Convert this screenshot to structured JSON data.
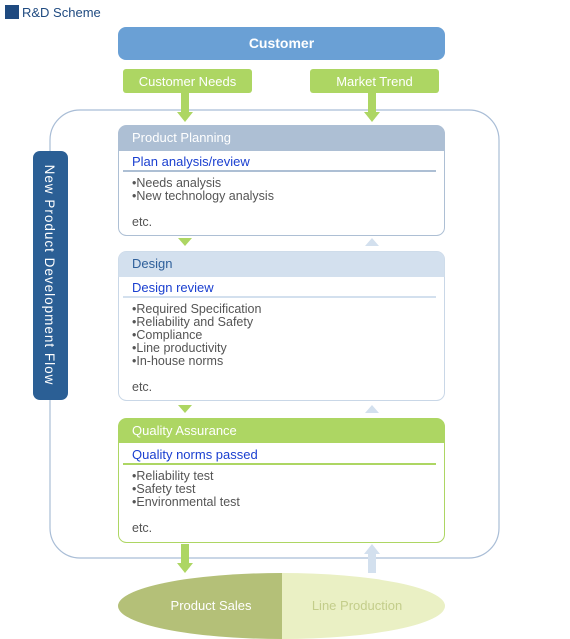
{
  "title": "R&D Scheme",
  "customer": "Customer",
  "inputs": [
    "Customer Needs",
    "Market Trend"
  ],
  "flow_label": "New Product Development Flow",
  "stages": [
    {
      "header": "Product Planning",
      "subtitle": "Plan analysis/review",
      "items": [
        "•Needs analysis",
        "•New technology analysis"
      ],
      "etc": "etc."
    },
    {
      "header": "Design",
      "subtitle": "Design review",
      "items": [
        "•Required Specification",
        "•Reliability and Safety",
        "•Compliance",
        "•Line productivity",
        "•In-house norms"
      ],
      "etc": "etc."
    },
    {
      "header": "Quality Assurance",
      "subtitle": "Quality norms passed",
      "items": [
        "•Reliability test",
        "•Safety test",
        "•Environmental test"
      ],
      "etc": "etc."
    }
  ],
  "outputs": [
    "Product Sales",
    "Line Production"
  ],
  "colors": {
    "navy": "#1f4a80",
    "customer_blue": "#6aa0d5",
    "green": "#add663",
    "planning_header": "#adbfd4",
    "design_header": "#d3e0ee",
    "flow_label_bg": "#2b5f95",
    "sales": "#b4c078",
    "production": "#eaf0c4"
  }
}
